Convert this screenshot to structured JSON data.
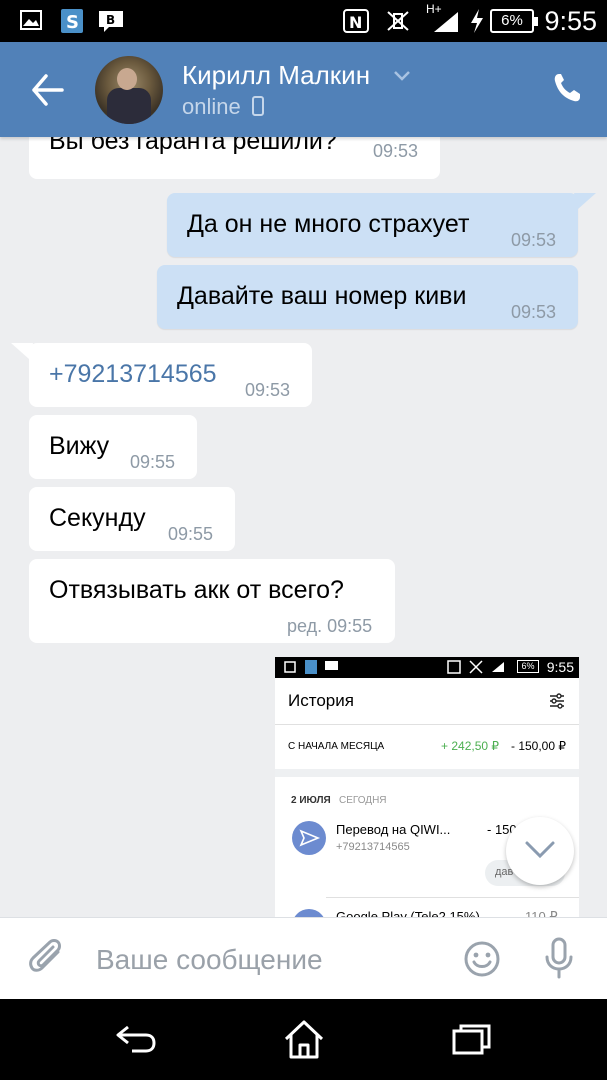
{
  "status_bar": {
    "time": "9:55",
    "battery": "6%",
    "network": "H+",
    "icons": [
      "gallery-icon",
      "s-app-icon",
      "message-notification-icon",
      "nfc-icon",
      "vibrate-icon",
      "signal-icon",
      "charging-icon",
      "battery-icon"
    ]
  },
  "header": {
    "contact_name": "Кирилл Малкин",
    "status": "online",
    "icons": [
      "back-arrow-icon",
      "chevron-down-icon",
      "mobile-icon",
      "phone-icon"
    ]
  },
  "messages": [
    {
      "direction": "in",
      "text": "Вы без гаранта решили?",
      "time": "09:53"
    },
    {
      "direction": "out",
      "text": "Да он не много страхует",
      "time": "09:53"
    },
    {
      "direction": "out",
      "text": "Давайте ваш номер киви",
      "time": "09:53"
    },
    {
      "direction": "in",
      "text": "+79213714565",
      "time": "09:53",
      "is_link": true
    },
    {
      "direction": "in",
      "text": "Вижу",
      "time": "09:55"
    },
    {
      "direction": "in",
      "text": "Секунду",
      "time": "09:55"
    },
    {
      "direction": "in",
      "text": "Отвязывать акк от всего?",
      "time": "ред. 09:55"
    }
  ],
  "attachment": {
    "status_time": "9:55",
    "status_battery": "6%",
    "title": "История",
    "period_label": "С НАЧАЛА МЕСЯЦА",
    "income": "+ 242,50 ₽",
    "expense": "- 150,00 ₽",
    "date": "2 ИЮЛЯ",
    "date_sub": "СЕГОДНЯ",
    "tx1_title": "Перевод на QIWI...",
    "tx1_sub": "+79213714565",
    "tx1_amount": "- 150",
    "tx1_pill": "дав",
    "tx2_title": "Google Play (Tele2 15%)",
    "tx2_amount": "110 ₽"
  },
  "input": {
    "placeholder": "Ваше сообщение"
  },
  "colors": {
    "header": "#5181b8",
    "outgoing_bubble": "#cce0f5",
    "incoming_bubble": "#ffffff",
    "background": "#edeef0",
    "link": "#4a76a8"
  }
}
